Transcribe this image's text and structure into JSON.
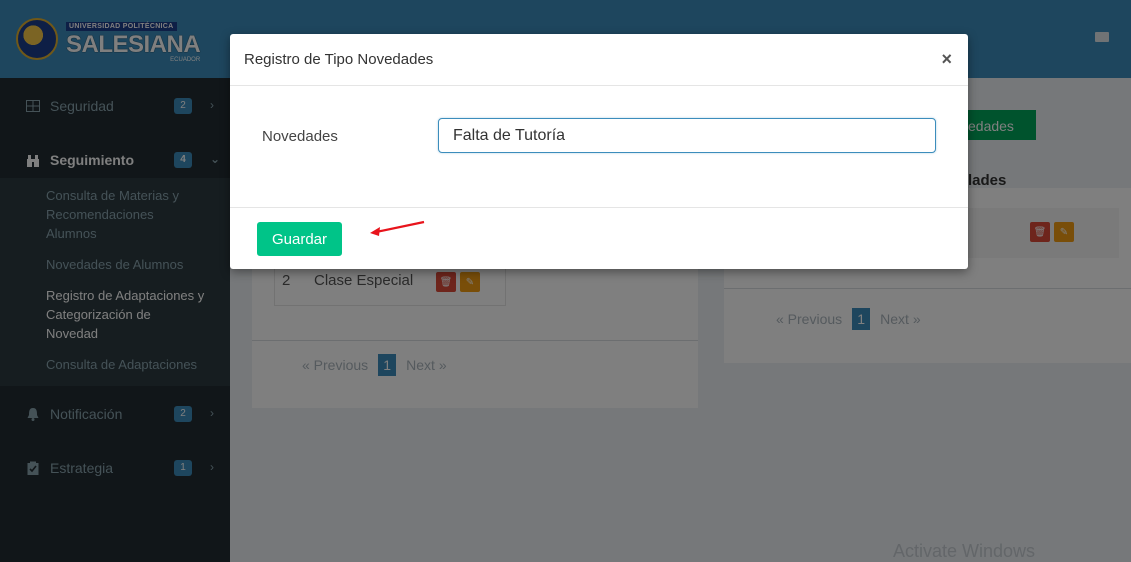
{
  "logo": {
    "university_line": "UNIVERSIDAD POLITÉCNICA",
    "name": "SALESIANA",
    "country": "ECUADOR"
  },
  "sidebar": {
    "items": [
      {
        "label": "Seguridad",
        "badge": "2",
        "icon": "grid-icon"
      },
      {
        "label": "Seguimiento",
        "badge": "4",
        "icon": "binoculars-icon"
      },
      {
        "label": "Notificación",
        "badge": "2",
        "icon": "bell-icon"
      },
      {
        "label": "Estrategia",
        "badge": "1",
        "icon": "clipboard-icon"
      }
    ],
    "submenu": [
      "Consulta de Materias y Recomendaciones Alumnos",
      "Novedades de Alumnos",
      "Registro de Adaptaciones y Categorización de Novedad",
      "Consulta de Adaptaciones"
    ]
  },
  "background": {
    "green_button_fragment": "edades",
    "panel_heading_fragment": "lades",
    "row": {
      "num": "2",
      "name": "Clase Especial"
    },
    "pager": {
      "prev": "« Previous",
      "page": "1",
      "next": "Next »"
    },
    "watermark": "Activate Windows"
  },
  "modal": {
    "title": "Registro de Tipo Novedades",
    "close": "×",
    "field_label": "Novedades",
    "field_value": "Falta de Tutoría",
    "save_label": "Guardar"
  },
  "colors": {
    "accent": "#3c8dbc",
    "save": "#00c488",
    "delete": "#dd4b39",
    "edit": "#f39c12",
    "arrow": "#e8141c"
  }
}
